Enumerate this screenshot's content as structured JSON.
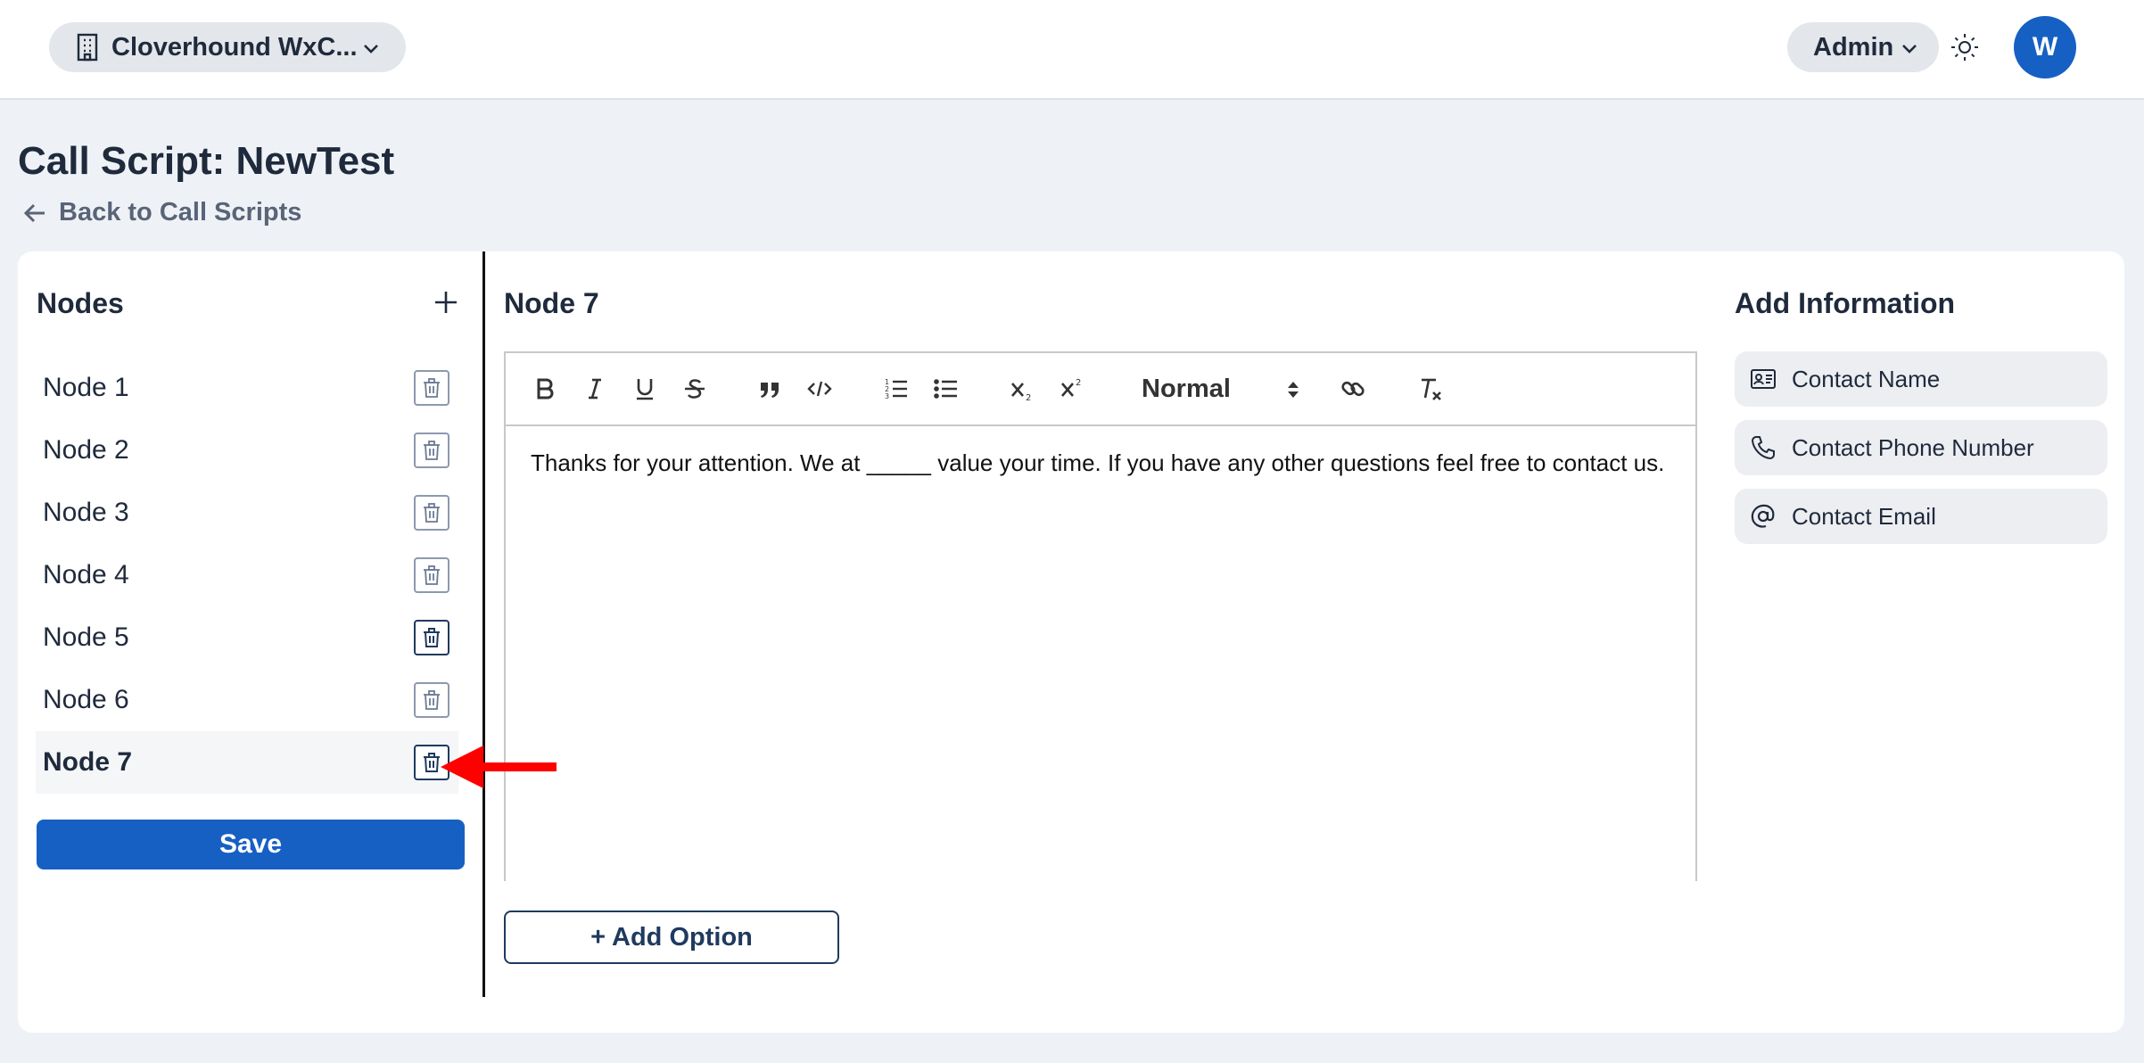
{
  "header": {
    "org_label": "Cloverhound WxC...",
    "role_label": "Admin",
    "avatar_initial": "W"
  },
  "page": {
    "title": "Call Script: NewTest",
    "back_label": "Back to Call Scripts"
  },
  "nodes": {
    "heading": "Nodes",
    "items": [
      {
        "label": "Node 1"
      },
      {
        "label": "Node 2"
      },
      {
        "label": "Node 3"
      },
      {
        "label": "Node 4"
      },
      {
        "label": "Node 5"
      },
      {
        "label": "Node 6"
      },
      {
        "label": "Node 7"
      }
    ],
    "active_index": 6,
    "save_label": "Save"
  },
  "editor": {
    "heading": "Node 7",
    "format_select": "Normal",
    "content": "Thanks for your attention. We at _____ value your time. If you have any other questions feel free to contact us.",
    "add_option_label": "+ Add Option"
  },
  "add_information": {
    "heading": "Add Information",
    "items": [
      {
        "label": "Contact Name",
        "icon": "contact-card-icon"
      },
      {
        "label": "Contact Phone Number",
        "icon": "phone-icon"
      },
      {
        "label": "Contact Email",
        "icon": "at-sign-icon"
      }
    ]
  },
  "colors": {
    "primary": "#1660c4",
    "annotation_arrow": "#ff0000"
  }
}
